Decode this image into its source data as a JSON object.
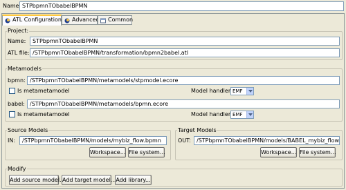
{
  "name_label": "Name:",
  "name_value": "STPbpmnTObabelBPMN",
  "tabs": [
    {
      "label": "ATL Configuration",
      "icon": "atl-config-icon"
    },
    {
      "label": "Advanced",
      "icon": "advanced-icon"
    },
    {
      "label": "Common",
      "icon": "common-icon"
    }
  ],
  "project": {
    "title": "Project:",
    "name_label": "Name:",
    "name_value": "STPbpmnTObabelBPMN",
    "atl_label": "ATL file:",
    "atl_value": "/STPbpmnTObabelBPMN/transformation/bpmn2babel.atl"
  },
  "metamodels": {
    "title": "Metamodels",
    "bpmn": {
      "label": "bpmn:",
      "value": "/STPbpmnTObabelBPMN/metamodels/stpmodel.ecore",
      "checkbox_label": "Is metametamodel",
      "handler_label": "Model handler:",
      "handler_value": "EMF"
    },
    "babel": {
      "label": "babel:",
      "value": "/STPbpmnTObabelBPMN/metamodels/bpmn.ecore",
      "checkbox_label": "Is metametamodel",
      "handler_label": "Model handler:",
      "handler_value": "EMF"
    }
  },
  "source_models": {
    "title": "Source Models",
    "in_label": "IN:",
    "in_value": "/STPbpmnTObabelBPMN/models/mybiz_flow.bpmn",
    "workspace_btn": "Workspace...",
    "filesystem_btn": "File system..."
  },
  "target_models": {
    "title": "Target Models",
    "out_label": "OUT:",
    "out_value": "/STPbpmnTObabelBPMN/models/BABEL_mybiz_flow.bpmn",
    "workspace_btn": "Workspace...",
    "filesystem_btn": "File system..."
  },
  "modify": {
    "title": "Modify",
    "add_source_btn": "Add source model...",
    "add_target_btn": "Add target model...",
    "add_library_btn": "Add library..."
  },
  "colors": {
    "dialog_bg": "#ece9d8",
    "field_border": "#7f9db9",
    "active_tab_accent": "#ffc83c"
  }
}
